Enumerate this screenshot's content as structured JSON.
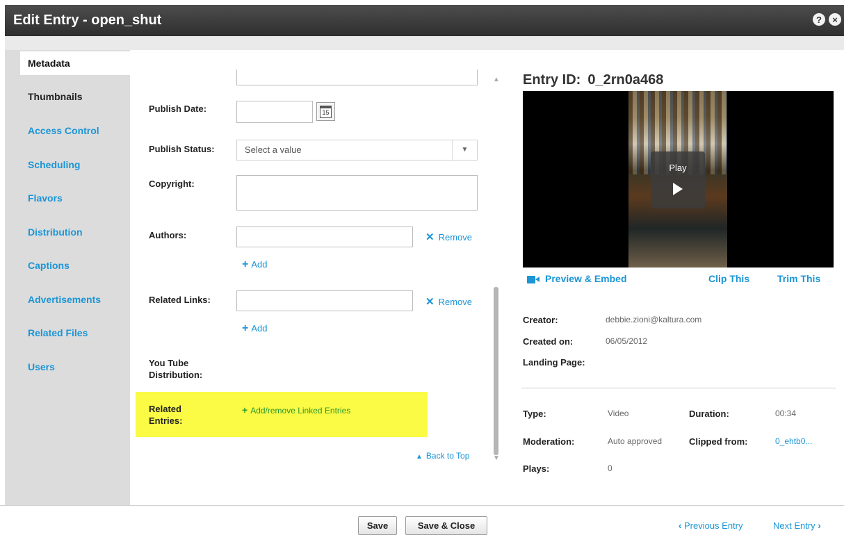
{
  "title": "Edit Entry - open_shut",
  "title_icons": {
    "help": "?",
    "close": "×"
  },
  "sidebar": {
    "items": [
      {
        "label": "Metadata"
      },
      {
        "label": "Thumbnails"
      },
      {
        "label": "Access Control"
      },
      {
        "label": "Scheduling"
      },
      {
        "label": "Flavors"
      },
      {
        "label": "Distribution"
      },
      {
        "label": "Captions"
      },
      {
        "label": "Advertisements"
      },
      {
        "label": "Related Files"
      },
      {
        "label": "Users"
      }
    ]
  },
  "form": {
    "publish_date_label": "Publish Date:",
    "calendar_day": "15",
    "publish_status_label": "Publish Status:",
    "publish_status_placeholder": "Select a value",
    "copyright_label": "Copyright:",
    "authors_label": "Authors:",
    "remove_label": "Remove",
    "add_label": "Add",
    "related_links_label": "Related Links:",
    "youtube_label_1": "You Tube",
    "youtube_label_2": "Distribution:",
    "related_entries_label_1": "Related",
    "related_entries_label_2": "Entries:",
    "add_remove_linked": "Add/remove Linked Entries",
    "back_to_top": "Back to Top"
  },
  "entry": {
    "id_label": "Entry ID:",
    "id_value": "0_2rn0a468",
    "play_label": "Play",
    "preview_embed": "Preview & Embed",
    "clip_this": "Clip This",
    "trim_this": "Trim This",
    "creator_label": "Creator:",
    "creator_value": "debbie.zioni@kaltura.com",
    "created_on_label": "Created on:",
    "created_on_value": "06/05/2012",
    "landing_page_label": "Landing Page:",
    "type_label": "Type:",
    "type_value": "Video",
    "duration_label": "Duration:",
    "duration_value": "00:34",
    "moderation_label": "Moderation:",
    "moderation_value": "Auto approved",
    "clipped_from_label": "Clipped from:",
    "clipped_from_value": "0_ehtb0...",
    "plays_label": "Plays:",
    "plays_value": "0"
  },
  "footer": {
    "save": "Save",
    "save_close": "Save & Close",
    "previous_entry": "Previous Entry",
    "next_entry": "Next Entry"
  },
  "colors": {
    "accent": "#1b95d6",
    "highlight": "#fbfa45",
    "add_green": "#2c9a2c",
    "titlebar": "#3a3a3a"
  }
}
